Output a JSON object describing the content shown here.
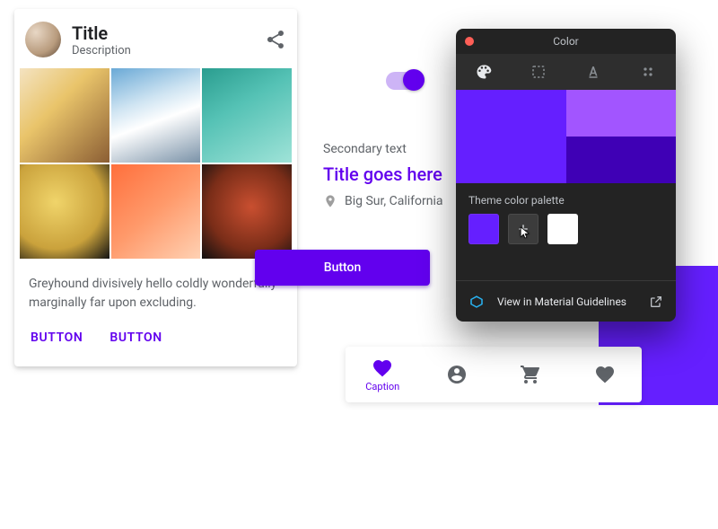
{
  "card": {
    "title": "Title",
    "subtitle": "Description",
    "body": "Greyhound divisively hello coldly wonderfully marginally far upon excluding.",
    "actions": [
      "BUTTON",
      "BUTTON"
    ]
  },
  "center": {
    "secondary": "Secondary text",
    "title": "Title goes here",
    "place": "Big Sur, California",
    "button": "Button",
    "switch_on": true
  },
  "bottom_nav": {
    "caption": "Caption"
  },
  "panel": {
    "title": "Color",
    "palette_label": "Theme color palette",
    "footer_link": "View in Material Guidelines",
    "colors": {
      "primary": "#651fff",
      "light": "#a255ff",
      "dark": "#3f00b5",
      "swatches": [
        "#651fff",
        "add",
        "#ffffff"
      ]
    }
  }
}
